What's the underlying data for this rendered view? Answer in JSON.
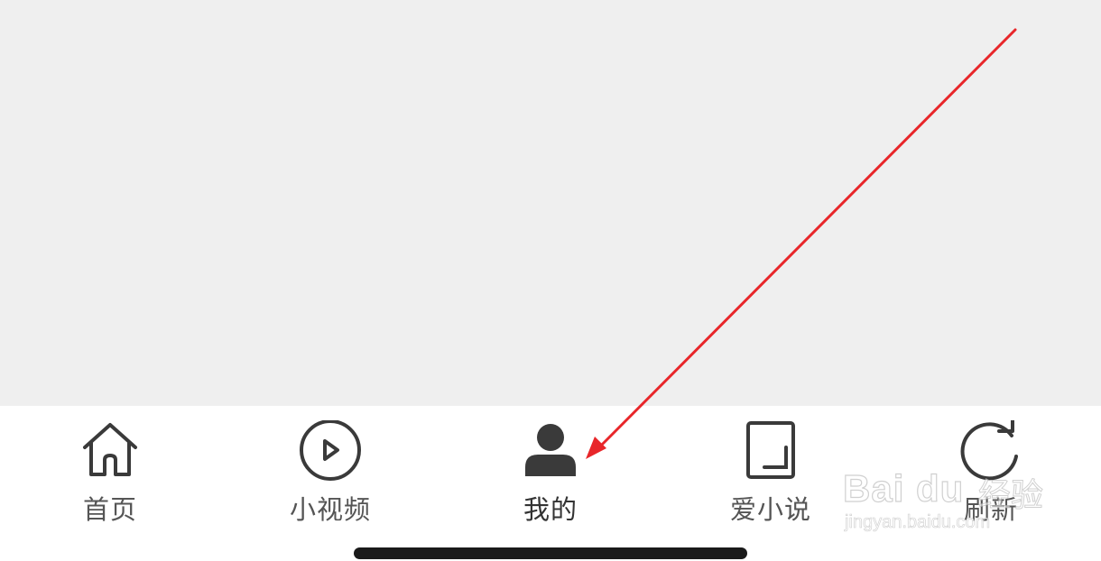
{
  "tabbar": {
    "items": [
      {
        "label": "首页",
        "icon": "home-icon",
        "active": false
      },
      {
        "label": "小视频",
        "icon": "play-circle-icon",
        "active": false
      },
      {
        "label": "我的",
        "icon": "user-icon",
        "active": true
      },
      {
        "label": "爱小说",
        "icon": "book-icon",
        "active": false
      },
      {
        "label": "刷新",
        "icon": "refresh-icon",
        "active": false
      }
    ]
  },
  "watermark": {
    "main": "Bai du",
    "cn": "经验",
    "sub": "jingyan.baidu.com"
  },
  "colors": {
    "background": "#efefef",
    "tabbar": "#ffffff",
    "icon": "#3a3a3a",
    "label": "#555555",
    "annotation_arrow": "#e8262a",
    "home_indicator": "#1a1a1a"
  }
}
